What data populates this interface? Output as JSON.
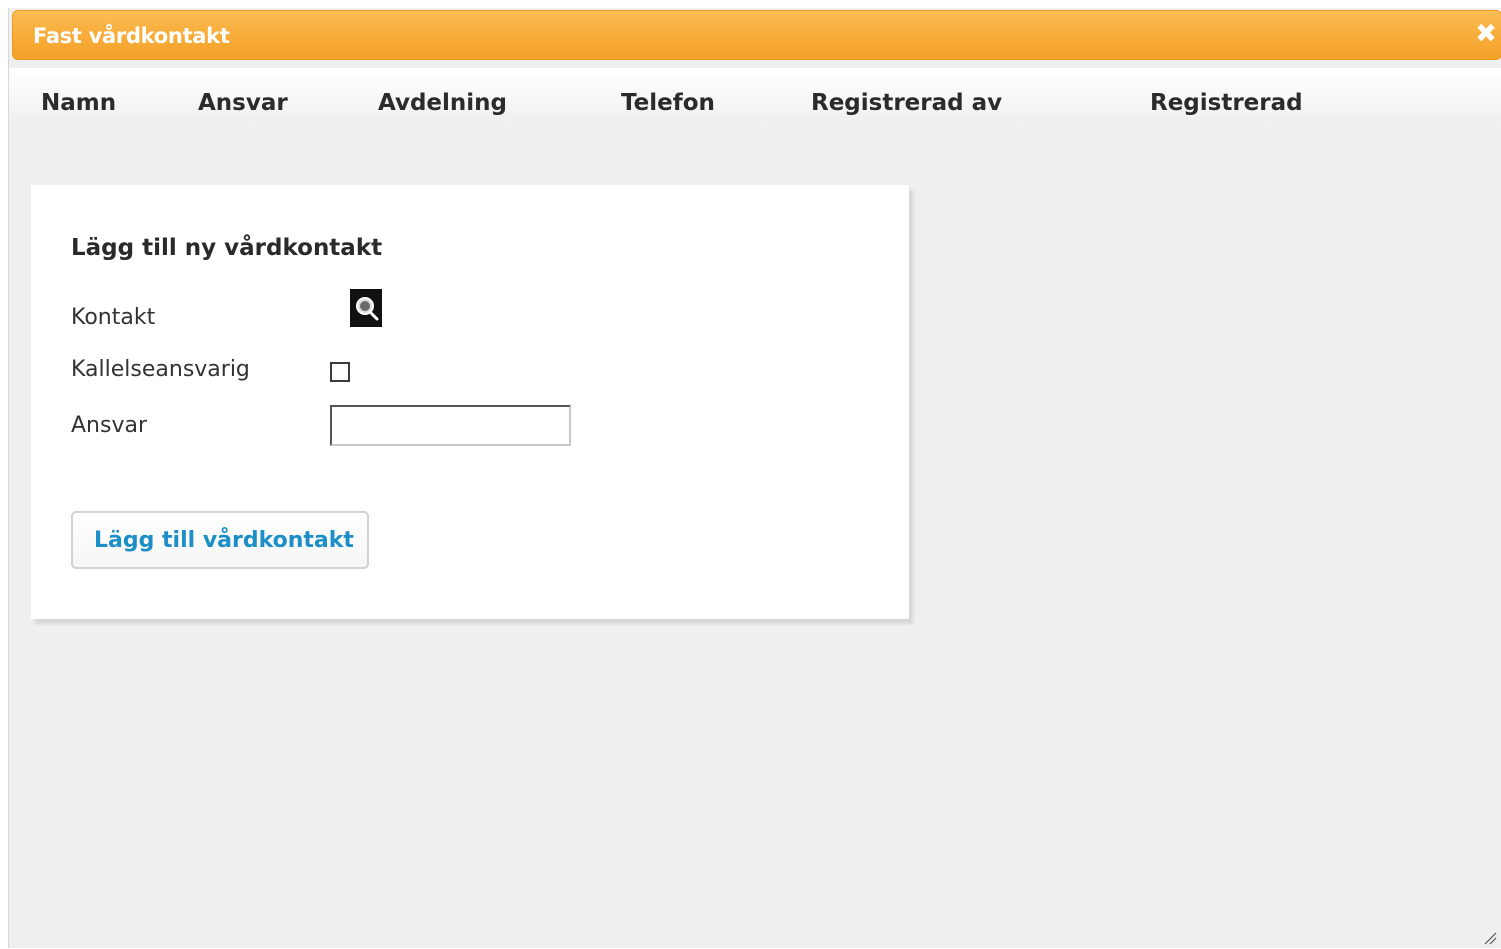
{
  "dialog": {
    "title": "Fast vårdkontakt",
    "close_glyph": "✖"
  },
  "table": {
    "columns": [
      "Namn",
      "Ansvar",
      "Avdelning",
      "Telefon",
      "Registrerad av",
      "Registrerad"
    ]
  },
  "form": {
    "heading": "Lägg till ny vårdkontakt",
    "contact_label": "Kontakt",
    "caller_label": "Kallelseansvarig",
    "caller_checked": false,
    "responsibility_label": "Ansvar",
    "responsibility_value": "",
    "submit_label": "Lägg till vårdkontakt"
  },
  "icons": {
    "search": "search-icon",
    "close": "close-icon",
    "resize": "resize-grip-icon"
  },
  "colors": {
    "titlebar": "#f8ad3a",
    "button_text": "#1e8fc6",
    "background": "#efefef"
  }
}
